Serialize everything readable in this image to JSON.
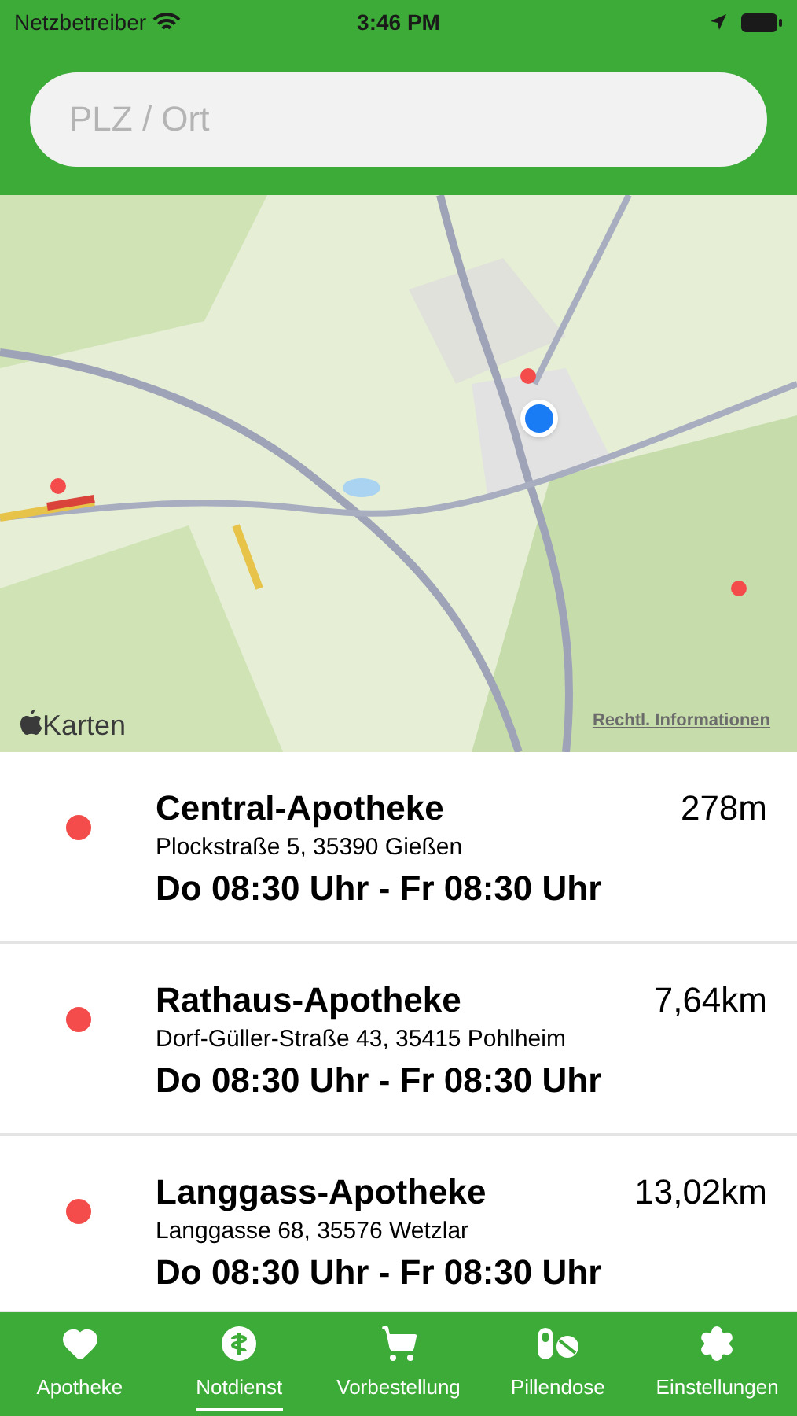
{
  "status_bar": {
    "carrier": "Netzbetreiber",
    "time": "3:46 PM"
  },
  "search": {
    "placeholder": "PLZ / Ort"
  },
  "map": {
    "attribution": "Karten",
    "legal_link": "Rechtl. Informationen"
  },
  "pharmacies": [
    {
      "name": "Central-Apotheke",
      "distance": "278m",
      "address": "Plockstraße 5, 35390 Gießen",
      "hours": "Do 08:30 Uhr - Fr 08:30 Uhr",
      "color": "#f44b4b"
    },
    {
      "name": "Rathaus-Apotheke",
      "distance": "7,64km",
      "address": "Dorf-Güller-Straße 43, 35415 Pohlheim",
      "hours": "Do 08:30 Uhr - Fr 08:30 Uhr",
      "color": "#f44b4b"
    },
    {
      "name": "Langgass-Apotheke",
      "distance": "13,02km",
      "address": "Langgasse 68, 35576 Wetzlar",
      "hours": "Do 08:30 Uhr - Fr 08:30 Uhr",
      "color": "#f44b4b"
    }
  ],
  "tabs": [
    {
      "label": "Apotheke",
      "kind": "heart",
      "selected": false
    },
    {
      "label": "Notdienst",
      "kind": "emergency",
      "selected": true
    },
    {
      "label": "Vorbestellung",
      "kind": "cart",
      "selected": false
    },
    {
      "label": "Pillendose",
      "kind": "pills",
      "selected": false
    },
    {
      "label": "Einstellungen",
      "kind": "gear",
      "selected": false
    }
  ]
}
